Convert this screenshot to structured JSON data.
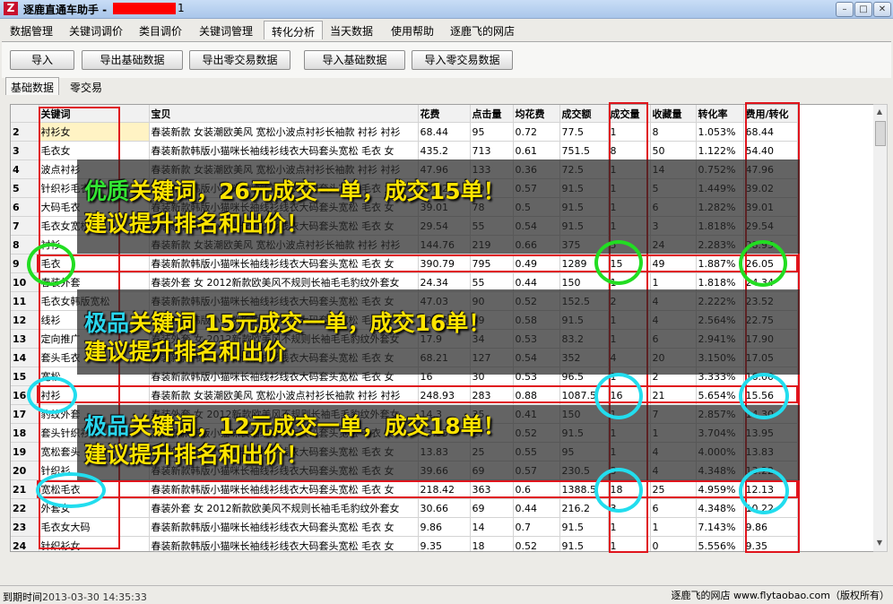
{
  "window": {
    "title": "逐鹿直通车助手 -",
    "title_suffix": "1",
    "buttons": [
      "–",
      "□",
      "✕"
    ]
  },
  "menu": [
    "数据管理",
    "关键词调价",
    "类目调价",
    "关键词管理",
    "转化分析",
    "当天数据",
    "使用帮助",
    "逐鹿飞的网店"
  ],
  "menu_active": "转化分析",
  "toolbar": [
    "导入",
    "导出基础数据",
    "导出零交易数据",
    "导入基础数据",
    "导入零交易数据"
  ],
  "subtabs": [
    "基础数据",
    "零交易"
  ],
  "table": {
    "headers": [
      "关键词",
      "宝贝",
      "花费",
      "点击量",
      "均花费",
      "成交额",
      "成交量",
      "收藏量",
      "转化率",
      "费用/转化"
    ],
    "rows": [
      [
        "2",
        "衬衫女",
        "春装新款 女装潮欧美风 宽松小波点衬衫长袖款 衬衫 衬衫",
        "68.44",
        "95",
        "0.72",
        "77.5",
        "1",
        "8",
        "1.053%",
        "68.44"
      ],
      [
        "3",
        "毛衣女",
        "春装新款韩版小猫咪长袖线衫线衣大码套头宽松 毛衣 女",
        "435.2",
        "713",
        "0.61",
        "751.5",
        "8",
        "50",
        "1.122%",
        "54.40"
      ],
      [
        "4",
        "波点衬衫",
        "春装新款 女装潮欧美风 宽松小波点衬衫长袖款 衬衫 衬衫",
        "47.96",
        "133",
        "0.36",
        "72.5",
        "1",
        "14",
        "0.752%",
        "47.96"
      ],
      [
        "5",
        "针织衫毛衣",
        "春装新款韩版小猫咪长袖线衫线衣大码套头宽松 毛衣 女",
        "39.02",
        "69",
        "0.57",
        "91.5",
        "1",
        "5",
        "1.449%",
        "39.02"
      ],
      [
        "6",
        "大码毛衣",
        "春装新款韩版小猫咪长袖线衫线衣大码套头宽松 毛衣 女",
        "39.01",
        "78",
        "0.5",
        "91.5",
        "1",
        "6",
        "1.282%",
        "39.01"
      ],
      [
        "7",
        "毛衣女宽松",
        "春装新款韩版小猫咪长袖线衫线衣大码套头宽松 毛衣 女",
        "29.54",
        "55",
        "0.54",
        "91.5",
        "1",
        "3",
        "1.818%",
        "29.54"
      ],
      [
        "8",
        "衬衫",
        "春装新款 女装潮欧美风 宽松小波点衬衫长袖款 衬衫 衬衫",
        "144.76",
        "219",
        "0.66",
        "375",
        "5",
        "24",
        "2.283%",
        "28.95"
      ],
      [
        "9",
        "毛衣",
        "春装新款韩版小猫咪长袖线衫线衣大码套头宽松 毛衣 女",
        "390.79",
        "795",
        "0.49",
        "1289",
        "15",
        "49",
        "1.887%",
        "26.05"
      ],
      [
        "10",
        "春装外套",
        "春装外套 女 2012新款欧美风不规则长袖毛毛豹纹外套女",
        "24.34",
        "55",
        "0.44",
        "150",
        "1",
        "1",
        "1.818%",
        "24.34"
      ],
      [
        "11",
        "毛衣女韩版宽松",
        "春装新款韩版小猫咪长袖线衫线衣大码套头宽松 毛衣 女",
        "47.03",
        "90",
        "0.52",
        "152.5",
        "2",
        "4",
        "2.222%",
        "23.52"
      ],
      [
        "12",
        "线衫",
        "春装新款韩版小猫咪长袖线衫线衣大码套头宽松 毛衣 女",
        "22.75",
        "39",
        "0.58",
        "91.5",
        "1",
        "4",
        "2.564%",
        "22.75"
      ],
      [
        "13",
        "定向推广",
        "春装外套 女 2012新款欧美风不规则长袖毛毛豹纹外套女",
        "17.9",
        "34",
        "0.53",
        "83.2",
        "1",
        "6",
        "2.941%",
        "17.90"
      ],
      [
        "14",
        "套头毛衣",
        "春装新款韩版小猫咪长袖线衫线衣大码套头宽松 毛衣 女",
        "68.21",
        "127",
        "0.54",
        "352",
        "4",
        "20",
        "3.150%",
        "17.05"
      ],
      [
        "15",
        "宽松",
        "春装新款韩版小猫咪长袖线衫线衣大码套头宽松 毛衣 女",
        "16",
        "30",
        "0.53",
        "96.5",
        "1",
        "2",
        "3.333%",
        "16.00"
      ],
      [
        "16",
        "衬衫",
        "春装新款 女装潮欧美风 宽松小波点衬衫长袖款 衬衫 衬衫",
        "248.93",
        "283",
        "0.88",
        "1087.5",
        "16",
        "21",
        "5.654%",
        "15.56"
      ],
      [
        "17",
        "豹纹外套",
        "春装外套 女 2012新款欧美风不规则长袖毛毛豹纹外套女",
        "14.3",
        "35",
        "0.41",
        "150",
        "1",
        "7",
        "2.857%",
        "14.30"
      ],
      [
        "18",
        "套头针织衫",
        "春装新款韩版小猫咪长袖线衫线衣大码套头宽松 毛衣 女",
        "13.95",
        "27",
        "0.52",
        "91.5",
        "1",
        "1",
        "3.704%",
        "13.95"
      ],
      [
        "19",
        "宽松套头",
        "春装新款韩版小猫咪长袖线衫线衣大码套头宽松 毛衣 女",
        "13.83",
        "25",
        "0.55",
        "95",
        "1",
        "4",
        "4.000%",
        "13.83"
      ],
      [
        "20",
        "针织衫",
        "春装新款韩版小猫咪长袖线衫线衣大码套头宽松 毛衣 女",
        "39.66",
        "69",
        "0.57",
        "230.5",
        "3",
        "4",
        "4.348%",
        "13.22"
      ],
      [
        "21",
        "宽松毛衣",
        "春装新款韩版小猫咪长袖线衫线衣大码套头宽松 毛衣 女",
        "218.42",
        "363",
        "0.6",
        "1388.5",
        "18",
        "25",
        "4.959%",
        "12.13"
      ],
      [
        "22",
        "外套女",
        "春装外套 女 2012新款欧美风不规则长袖毛毛豹纹外套女",
        "30.66",
        "69",
        "0.44",
        "216.2",
        "3",
        "6",
        "4.348%",
        "10.22"
      ],
      [
        "23",
        "毛衣女大码",
        "春装新款韩版小猫咪长袖线衫线衣大码套头宽松 毛衣 女",
        "9.86",
        "14",
        "0.7",
        "91.5",
        "1",
        "1",
        "7.143%",
        "9.86"
      ],
      [
        "24",
        "针织衫女",
        "春装新款韩版小猫咪长袖线衫线衣大码套头宽松 毛衣 女",
        "9.35",
        "18",
        "0.52",
        "91.5",
        "1",
        "0",
        "5.556%",
        "9.35"
      ]
    ]
  },
  "annotations": [
    {
      "tag": "优质",
      "line1": "关键词，26元成交一单，成交15单！",
      "line2": "建议提升排名和出价！"
    },
    {
      "tag": "极品",
      "line1": "关键词  15元成交一单，成交16单！",
      "line2": "建议提升排名和出价"
    },
    {
      "tag": "极品",
      "line1": "关键词，12元成交一单，成交18单！",
      "line2": "建议提升排名和出价！"
    }
  ],
  "status": {
    "expire_label": "到期时间",
    "expire_date": "2013-03-30 14:35:33",
    "shop": "逐鹿飞的网店 www.flytaobao.com（版权所有）"
  },
  "colors": {
    "tag_green": "#33e633",
    "tag_cyan": "#2ad6ee",
    "promo_text": "#ffe400",
    "highlight_red": "#e0141c",
    "ring_green": "#22dd22",
    "ring_cyan": "#22ddee"
  }
}
